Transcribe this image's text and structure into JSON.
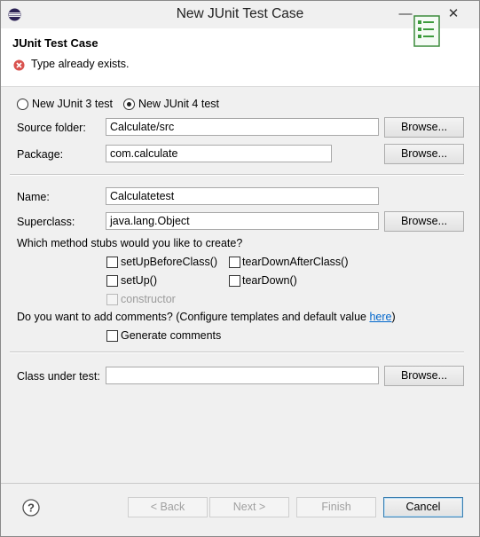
{
  "window": {
    "title": "New JUnit Test Case"
  },
  "header": {
    "title": "JUnit Test Case",
    "message": "Type already exists."
  },
  "version": {
    "junit3": "New JUnit 3 test",
    "junit4": "New JUnit 4 test",
    "selected": "junit4"
  },
  "source": {
    "label": "Source folder:",
    "value": "Calculate/src"
  },
  "package": {
    "label": "Package:",
    "value": "com.calculate"
  },
  "name": {
    "label": "Name:",
    "value": "Calculatetest"
  },
  "superclass": {
    "label": "Superclass:",
    "value": "java.lang.Object"
  },
  "browse_label": "Browse...",
  "stubs": {
    "question": "Which method stubs would you like to create?",
    "setUpBeforeClass": "setUpBeforeClass()",
    "tearDownAfterClass": "tearDownAfterClass()",
    "setUp": "setUp()",
    "tearDown": "tearDown()",
    "constructor": "constructor"
  },
  "comments": {
    "question": "Do you want to add comments? (Configure templates and default value ",
    "link": "here",
    "close": ")",
    "generate": "Generate comments"
  },
  "class_under_test": {
    "label": "Class under test:",
    "value": ""
  },
  "buttons": {
    "back": "< Back",
    "next": "Next >",
    "finish": "Finish",
    "cancel": "Cancel"
  },
  "icons": [
    "app-eclipse-icon",
    "minimize-icon",
    "close-icon",
    "error-icon",
    "junit-banner-icon",
    "help-icon"
  ]
}
